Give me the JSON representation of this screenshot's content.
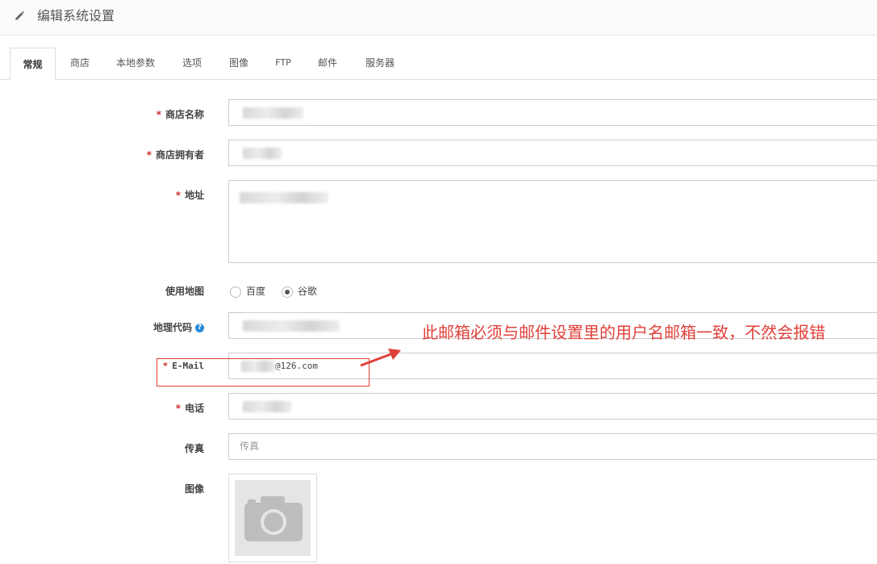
{
  "header": {
    "title": "编辑系统设置",
    "icon": "pencil-icon"
  },
  "tabs": [
    {
      "label": "常规",
      "active": true
    },
    {
      "label": "商店",
      "active": false
    },
    {
      "label": "本地参数",
      "active": false
    },
    {
      "label": "选项",
      "active": false
    },
    {
      "label": "图像",
      "active": false
    },
    {
      "label": "FTP",
      "active": false
    },
    {
      "label": "邮件",
      "active": false
    },
    {
      "label": "服务器",
      "active": false
    }
  ],
  "form": {
    "required_mark": "*",
    "store_name": {
      "label": "商店名称",
      "required": true
    },
    "store_owner": {
      "label": "商店拥有者",
      "required": true
    },
    "address": {
      "label": "地址",
      "required": true
    },
    "map": {
      "label": "使用地图",
      "options": [
        {
          "label": "百度",
          "checked": false
        },
        {
          "label": "谷歌",
          "checked": true
        }
      ]
    },
    "geocode": {
      "label": "地理代码",
      "help_icon": "?"
    },
    "email": {
      "label": "E-Mail",
      "required": true,
      "value_suffix": "@126.com"
    },
    "phone": {
      "label": "电话",
      "required": true
    },
    "fax": {
      "label": "传真",
      "placeholder": "传真"
    },
    "image": {
      "label": "图像",
      "icon": "camera-icon"
    }
  },
  "annotation": {
    "text": "此邮箱必须与邮件设置里的用户名邮箱一致，不然会报错",
    "color": "#e0403a"
  }
}
